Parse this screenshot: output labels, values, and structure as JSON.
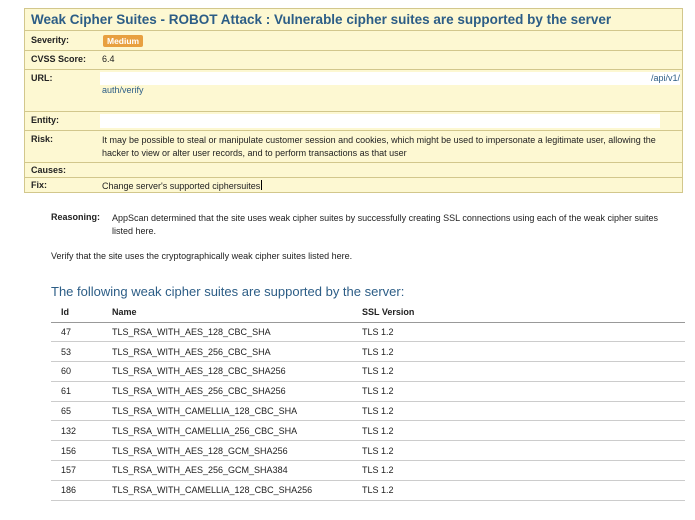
{
  "issue": {
    "title": "Weak Cipher Suites - ROBOT Attack : Vulnerable cipher suites are supported by the server",
    "severity_label": "Severity:",
    "severity": "Medium",
    "severity_color": "#e8a040",
    "cvss_label": "CVSS Score:",
    "cvss": "6.4",
    "url_label": "URL:",
    "url_end": "/api/v1/",
    "url_line2": "auth/verify",
    "entity_label": "Entity:",
    "risk_label": "Risk:",
    "risk": "It may be possible to steal or manipulate customer session and cookies, which might be used to impersonate a legitimate user, allowing the hacker to view or alter user records, and to perform transactions as that user",
    "causes_label": "Causes:",
    "fix_label": "Fix:",
    "fix": "Change server's supported ciphersuites"
  },
  "reasoning": {
    "label": "Reasoning:",
    "text": "AppScan determined that the site uses weak cipher suites by successfully creating SSL connections using each of the weak cipher suites listed here.",
    "verify": "Verify that the site uses the cryptographically weak cipher suites listed here."
  },
  "ciphers": {
    "heading": "The following weak cipher suites are supported by the server:",
    "headers": [
      "Id",
      "Name",
      "SSL Version"
    ],
    "rows": [
      [
        "47",
        "TLS_RSA_WITH_AES_128_CBC_SHA",
        "TLS 1.2"
      ],
      [
        "53",
        "TLS_RSA_WITH_AES_256_CBC_SHA",
        "TLS 1.2"
      ],
      [
        "60",
        "TLS_RSA_WITH_AES_128_CBC_SHA256",
        "TLS 1.2"
      ],
      [
        "61",
        "TLS_RSA_WITH_AES_256_CBC_SHA256",
        "TLS 1.2"
      ],
      [
        "65",
        "TLS_RSA_WITH_CAMELLIA_128_CBC_SHA",
        "TLS 1.2"
      ],
      [
        "132",
        "TLS_RSA_WITH_CAMELLIA_256_CBC_SHA",
        "TLS 1.2"
      ],
      [
        "156",
        "TLS_RSA_WITH_AES_128_GCM_SHA256",
        "TLS 1.2"
      ],
      [
        "157",
        "TLS_RSA_WITH_AES_256_GCM_SHA384",
        "TLS 1.2"
      ],
      [
        "186",
        "TLS_RSA_WITH_CAMELLIA_128_CBC_SHA256",
        "TLS 1.2"
      ]
    ]
  }
}
